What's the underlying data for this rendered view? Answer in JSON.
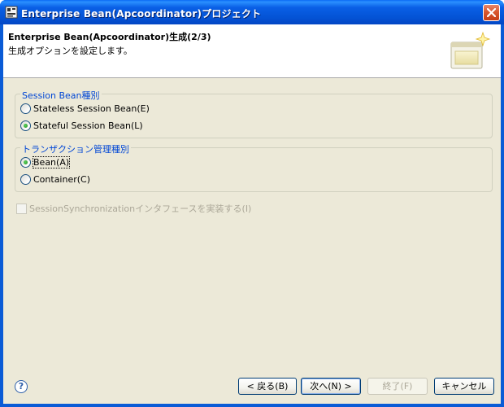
{
  "window": {
    "title": "Enterprise Bean(Apcoordinator)プロジェクト",
    "close_icon": "close-icon"
  },
  "banner": {
    "title": "Enterprise Bean(Apcoordinator)生成(2/3)",
    "message": "生成オプションを設定します。",
    "icon": "wizard-banner-icon"
  },
  "session_group": {
    "legend": "Session Bean種別",
    "options": [
      {
        "label": "Stateless Session Bean(E)",
        "checked": false
      },
      {
        "label": "Stateful Session Bean(L)",
        "checked": true
      }
    ]
  },
  "transaction_group": {
    "legend": "トランザクション管理種別",
    "options": [
      {
        "label": "Bean(A)",
        "checked": true
      },
      {
        "label": "Container(C)",
        "checked": false
      }
    ]
  },
  "sync_checkbox": {
    "label": "SessionSynchronizationインタフェースを実装する(I)",
    "checked": false,
    "enabled": false
  },
  "footer": {
    "help_icon": "help-icon",
    "back_label": "< 戻る(B)",
    "next_label": "次へ(N) >",
    "finish_label": "終了(F)",
    "cancel_label": "キャンセル"
  },
  "colors": {
    "titlebar": "#0454d6",
    "dialog_bg": "#ece9d8",
    "legend": "#0046d5"
  }
}
